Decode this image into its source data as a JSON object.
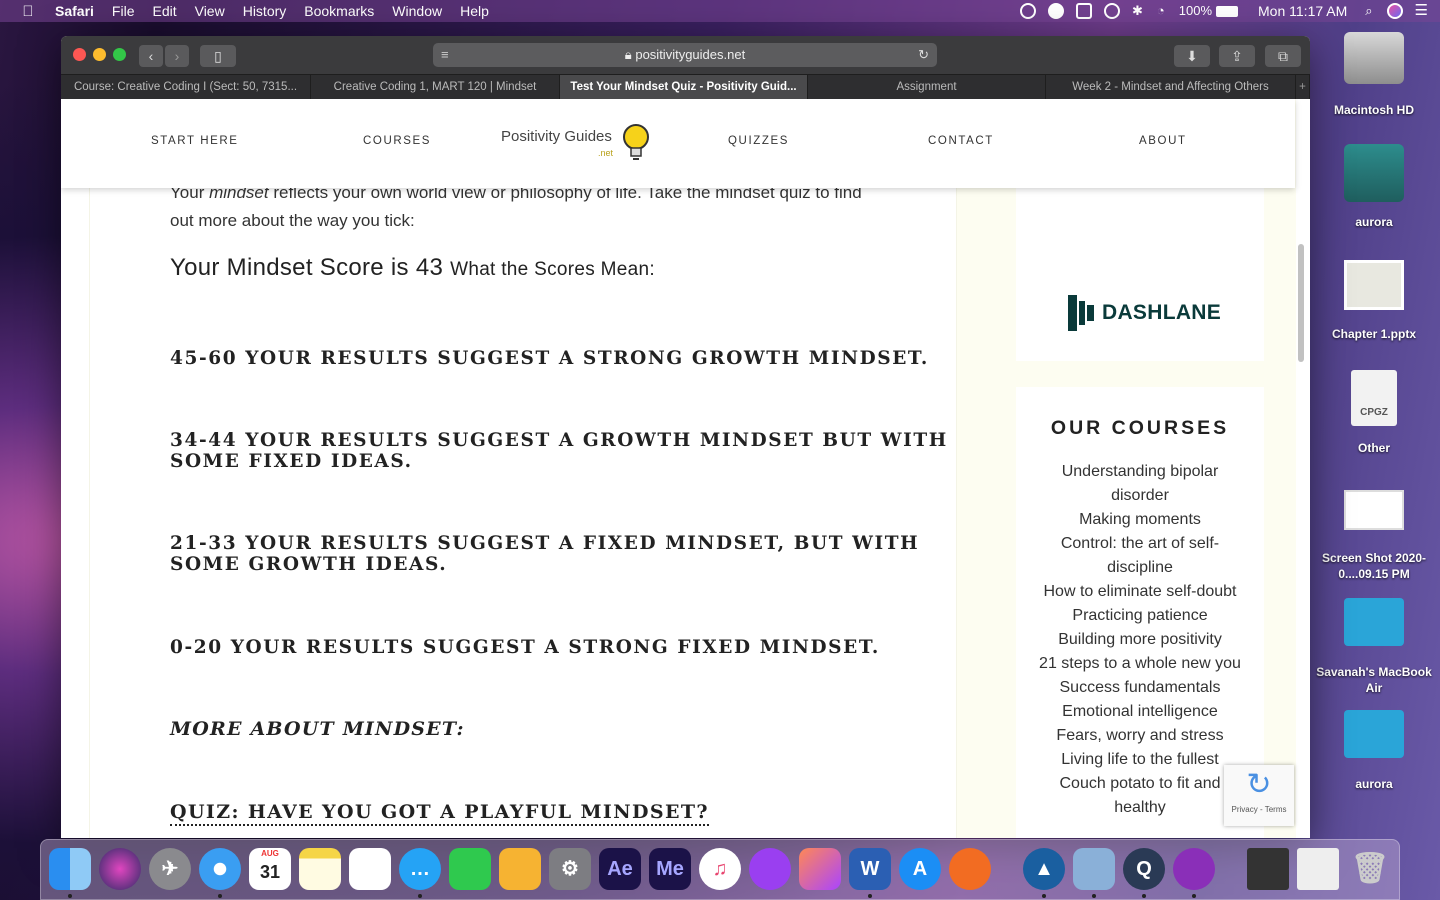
{
  "menubar": {
    "app": "Safari",
    "items": [
      "File",
      "Edit",
      "View",
      "History",
      "Bookmarks",
      "Window",
      "Help"
    ],
    "battery": "100%",
    "clock": "Mon 11:17 AM"
  },
  "browser": {
    "url": "positivityguides.net",
    "tabs": [
      "Course: Creative Coding I (Sect: 50, 7315...",
      "Creative Coding 1, MART 120 | Mindset",
      "Test Your Mindset Quiz - Positivity Guid...",
      "Assignment",
      "Week 2 - Mindset and Affecting Others"
    ],
    "active_tab": 2
  },
  "site": {
    "nav": {
      "start_here": "START HERE",
      "courses": "COURSES",
      "quizzes": "QUIZZES",
      "contact": "CONTACT",
      "about": "ABOUT"
    },
    "logo_text": "Positivity Guides",
    "logo_sub": ".net"
  },
  "main": {
    "intro_line1_a": "Your ",
    "intro_line1_em": "mindset",
    "intro_line1_b": " reflects your own world view or philosophy of life. Take the mindset quiz to find",
    "intro_line2": "out more about the way you tick:",
    "score_label": "Your Mindset Score is",
    "score_value": "43",
    "scores_heading": "What the Scores Mean:",
    "results": [
      "45-60 Your results suggest a strong growth mindset.",
      "34-44 Your results suggest a growth mindset but with some fixed ideas.",
      "21-33 Your results suggest a fixed mindset, but with some growth ideas.",
      "0-20 Your results suggest a strong fixed mindset."
    ],
    "more_heading": "MORE ABOUT MINDSET:",
    "quiz_link": "QUIZ: HAVE YOU GOT A PLAYFUL MINDSET?"
  },
  "sidebar": {
    "ad_brand": "DASHLANE",
    "courses_title": "OUR COURSES",
    "courses": [
      "Understanding bipolar disorder",
      "Making moments",
      "Control: the art of self-discipline",
      "How to eliminate self-doubt",
      "Practicing patience",
      "Building more positivity",
      "21 steps to a whole new you",
      "Success fundamentals",
      "Emotional intelligence",
      "Fears, worry and stress",
      "Living life to the fullest",
      "Couch potato to fit and healthy"
    ],
    "recaptcha_links": "Privacy - Terms"
  },
  "desktop": {
    "icons": [
      "Macintosh HD",
      "aurora",
      "Chapter 1.pptx",
      "Other",
      "Screen Shot 2020-0....09.15 PM",
      "Savanah's MacBook Air",
      "aurora"
    ],
    "other_badge": "CPGZ"
  },
  "dock": {
    "calendar_month": "AUG",
    "calendar_day": "31",
    "ae": "Ae",
    "me": "Me"
  }
}
